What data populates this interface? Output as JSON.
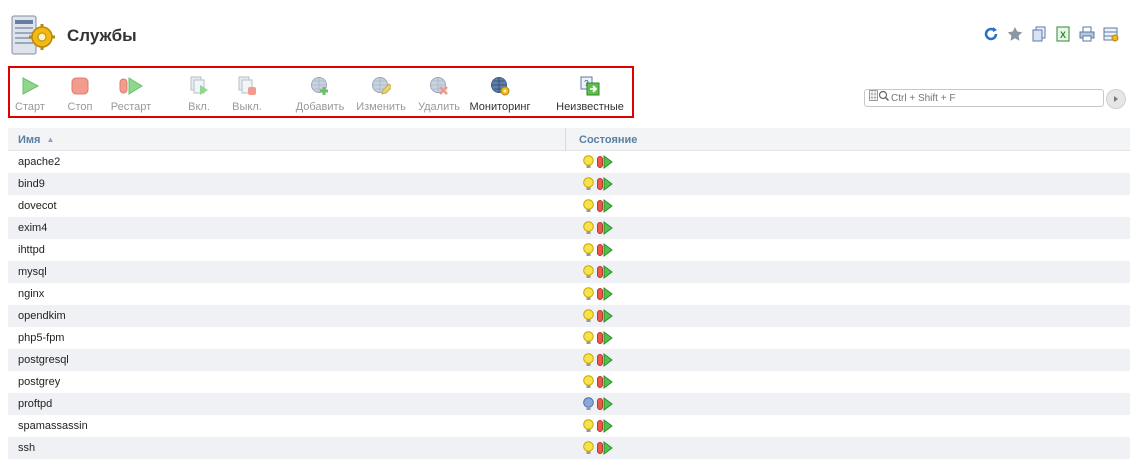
{
  "header": {
    "title": "Службы",
    "top_icons": [
      "refresh-icon",
      "favorite-star-icon",
      "copy-icon",
      "export-excel-icon",
      "print-icon",
      "table-settings-icon"
    ]
  },
  "toolbar": {
    "buttons": [
      {
        "label": "Старт",
        "icon": "start-icon",
        "active": false
      },
      {
        "label": "Стоп",
        "icon": "stop-icon",
        "active": false
      },
      {
        "label": "Рестарт",
        "icon": "restart-icon",
        "active": false
      },
      {
        "label": "Вкл.",
        "icon": "enable-icon",
        "active": false
      },
      {
        "label": "Выкл.",
        "icon": "disable-icon",
        "active": false
      },
      {
        "label": "Добавить",
        "icon": "add-monitor-icon",
        "active": false
      },
      {
        "label": "Изменить",
        "icon": "edit-monitor-icon",
        "active": false
      },
      {
        "label": "Удалить",
        "icon": "delete-monitor-icon",
        "active": false
      },
      {
        "label": "Мониторинг",
        "icon": "monitoring-icon",
        "active": true
      },
      {
        "label": "Неизвестные",
        "icon": "unknown-icon",
        "active": true
      }
    ]
  },
  "search": {
    "placeholder": "Ctrl + Shift + F"
  },
  "table": {
    "columns": {
      "name": "Имя",
      "state": "Состояние"
    },
    "sort": {
      "column": "name",
      "direction": "asc"
    },
    "rows": [
      {
        "name": "apache2",
        "status": "running"
      },
      {
        "name": "bind9",
        "status": "running"
      },
      {
        "name": "dovecot",
        "status": "running"
      },
      {
        "name": "exim4",
        "status": "running"
      },
      {
        "name": "ihttpd",
        "status": "running"
      },
      {
        "name": "mysql",
        "status": "running"
      },
      {
        "name": "nginx",
        "status": "running"
      },
      {
        "name": "opendkim",
        "status": "running"
      },
      {
        "name": "php5-fpm",
        "status": "running"
      },
      {
        "name": "postgresql",
        "status": "running"
      },
      {
        "name": "postgrey",
        "status": "running"
      },
      {
        "name": "proftpd",
        "status": "inetd"
      },
      {
        "name": "spamassassin",
        "status": "running"
      },
      {
        "name": "ssh",
        "status": "running"
      }
    ]
  },
  "colors": {
    "highlight_border": "#e00000",
    "header_text": "#5a7fa3",
    "row_alt": "#eff1f4"
  }
}
